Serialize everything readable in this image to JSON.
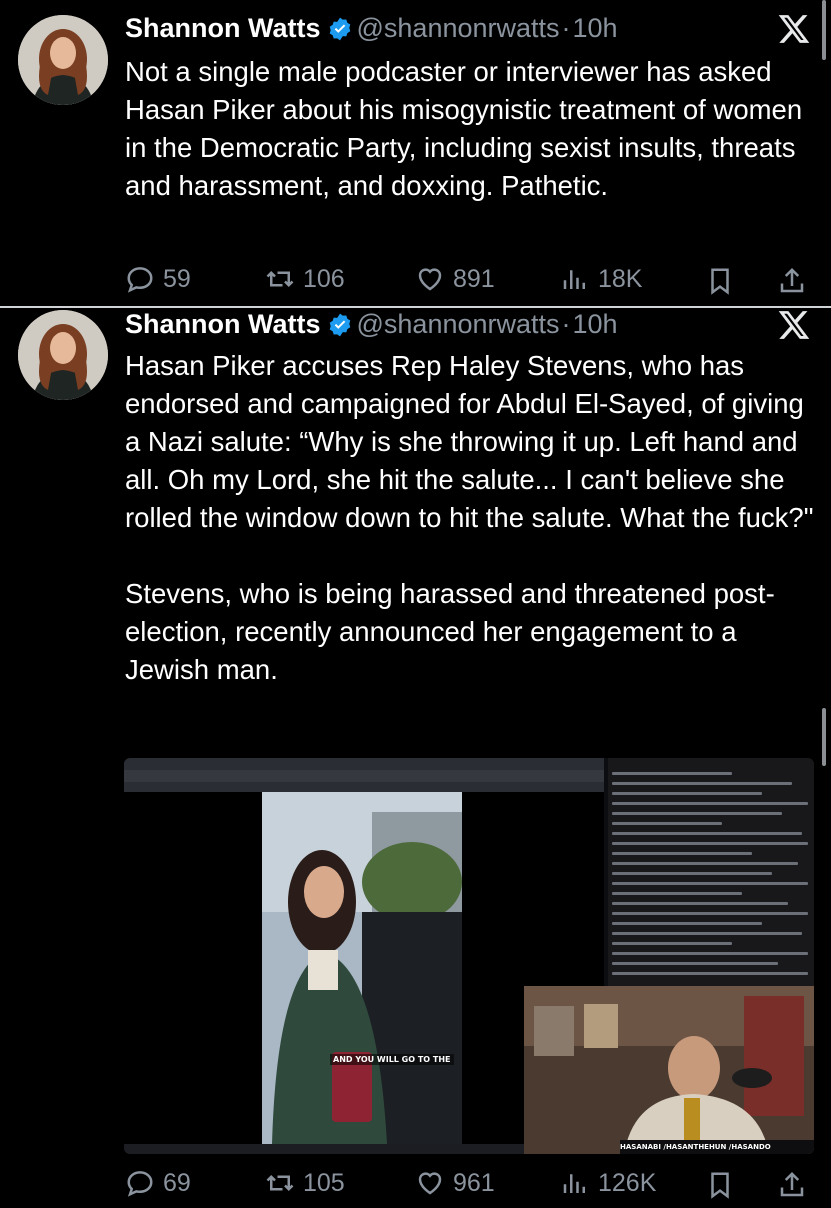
{
  "tweets": [
    {
      "author": "Shannon Watts",
      "handle": "@shannonrwatts",
      "separator": "·",
      "time": "10h",
      "text": "Not a single male podcaster or interviewer has asked Hasan Piker about his misogynistic treatment of women in the Democratic Party, including sexist insults, threats and harassment, and doxxing. Pathetic.",
      "replies": "59",
      "reposts": "106",
      "likes": "891",
      "views": "18K"
    },
    {
      "author": "Shannon Watts",
      "handle": "@shannonrwatts",
      "separator": "·",
      "time": "10h",
      "text": "Hasan Piker accuses Rep Haley Stevens, who has endorsed and campaigned for Abdul El-Sayed, of giving a Nazi salute: “Why is she throwing it up. Left hand and all. Oh my Lord, she hit the salute... I can't believe she rolled the window down to hit the salute. What the fuck?\"\n\nStevens, who is being harassed and threatened post-election, recently announced her engagement to a Jewish man.",
      "replies": "69",
      "reposts": "105",
      "likes": "961",
      "views": "126K",
      "media": {
        "video_caption": "AND YOU WILL GO TO THE",
        "stream_banner": "HASANABI  /HASANTHEHUN  /HASANDO"
      }
    }
  ],
  "icons": {
    "verified": "verified-badge-icon",
    "x_logo": "x-logo-icon",
    "reply": "reply-icon",
    "repost": "repost-icon",
    "like": "heart-icon",
    "views": "views-icon",
    "bookmark": "bookmark-icon",
    "share": "share-icon"
  },
  "colors": {
    "background": "#000000",
    "text": "#e7e9ea",
    "muted": "#8b949e",
    "verified": "#1d9bf0"
  }
}
